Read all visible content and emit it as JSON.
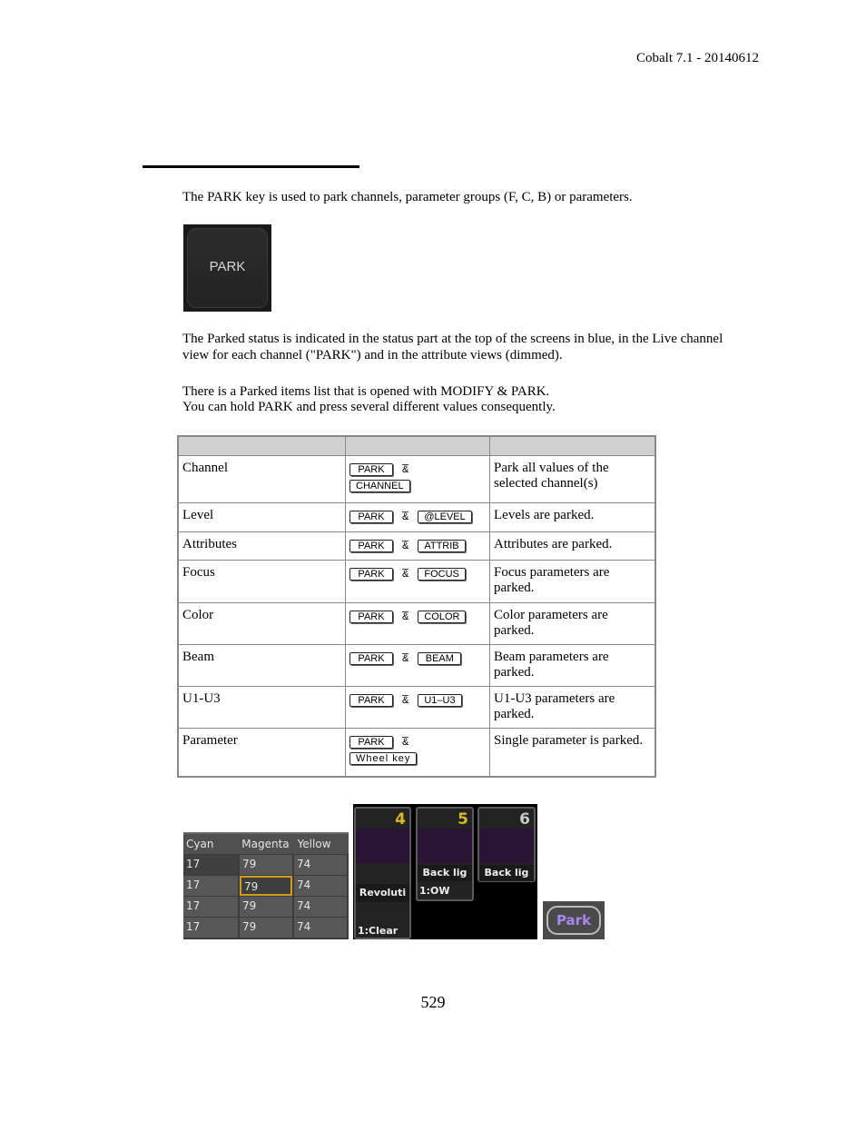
{
  "header": {
    "doc_version": "Cobalt 7.1 - 20140612"
  },
  "intro": "The PARK key is used to park channels, parameter groups (F, C, B) or parameters.",
  "park_key_label": "PARK",
  "status_paragraph": [
    "The Parked status is indicated in the status part at the top of the screens in blue, in the Live channel",
    "view for each channel (\"PARK\") and in the attribute views (dimmed)."
  ],
  "list_paragraph": [
    "There is a Parked items list that is opened with MODIFY & PARK.",
    "You can hold PARK and press several different values consequently."
  ],
  "table": {
    "headers": [
      "",
      "",
      ""
    ],
    "rows": [
      {
        "item": "Channel",
        "key1": "PARK",
        "amp": "&",
        "key2": "CHANNEL",
        "desc": "Park all values of the selected channel(s)",
        "wrap": true
      },
      {
        "item": "Level",
        "key1": "PARK",
        "amp": "&",
        "key2": "@LEVEL",
        "desc": "Levels are parked."
      },
      {
        "item": "Attributes",
        "key1": "PARK",
        "amp": "&",
        "key2": "ATTRIB",
        "desc": "Attributes are parked."
      },
      {
        "item": "Focus",
        "key1": "PARK",
        "amp": "&",
        "key2": "FOCUS",
        "desc": "Focus parameters are parked."
      },
      {
        "item": "Color",
        "key1": "PARK",
        "amp": "&",
        "key2": "COLOR",
        "desc": "Color parameters are parked."
      },
      {
        "item": "Beam",
        "key1": "PARK",
        "amp": "&",
        "key2": "BEAM",
        "desc": "Beam parameters are parked."
      },
      {
        "item": "U1-U3",
        "key1": "PARK",
        "amp": "&",
        "key2": "U1–U3",
        "desc": "U1-U3 parameters are parked."
      },
      {
        "item": "Parameter",
        "key1": "PARK",
        "amp": "&",
        "key2": "Wheel key",
        "desc": "Single parameter is parked.",
        "wrap": true
      }
    ]
  },
  "cmy_view": {
    "headers": [
      "Cyan",
      "Magenta",
      "Yellow"
    ],
    "rows": [
      [
        "17",
        "79",
        "74"
      ],
      [
        "17",
        "79",
        "74"
      ],
      [
        "17",
        "79",
        "74"
      ],
      [
        "17",
        "79",
        "74"
      ]
    ],
    "selected_cell": "row 2, Magenta"
  },
  "fixture_tiles": [
    {
      "number": "4",
      "name": "Revoluti",
      "value": "1:Clear",
      "number_color": "#d4b92a"
    },
    {
      "number": "5",
      "name": "Back lig",
      "value": "1:OW",
      "number_color": "#d4b92a"
    },
    {
      "number": "6",
      "name": "Back lig",
      "value": "",
      "number_color": "#c8c8c8"
    }
  ],
  "park_badge": "Park",
  "colors": {
    "park_badge_text": "#a986f0",
    "selection_outline": "#d49a1a",
    "fixture_color": "#2b1537"
  },
  "page_number": "529"
}
